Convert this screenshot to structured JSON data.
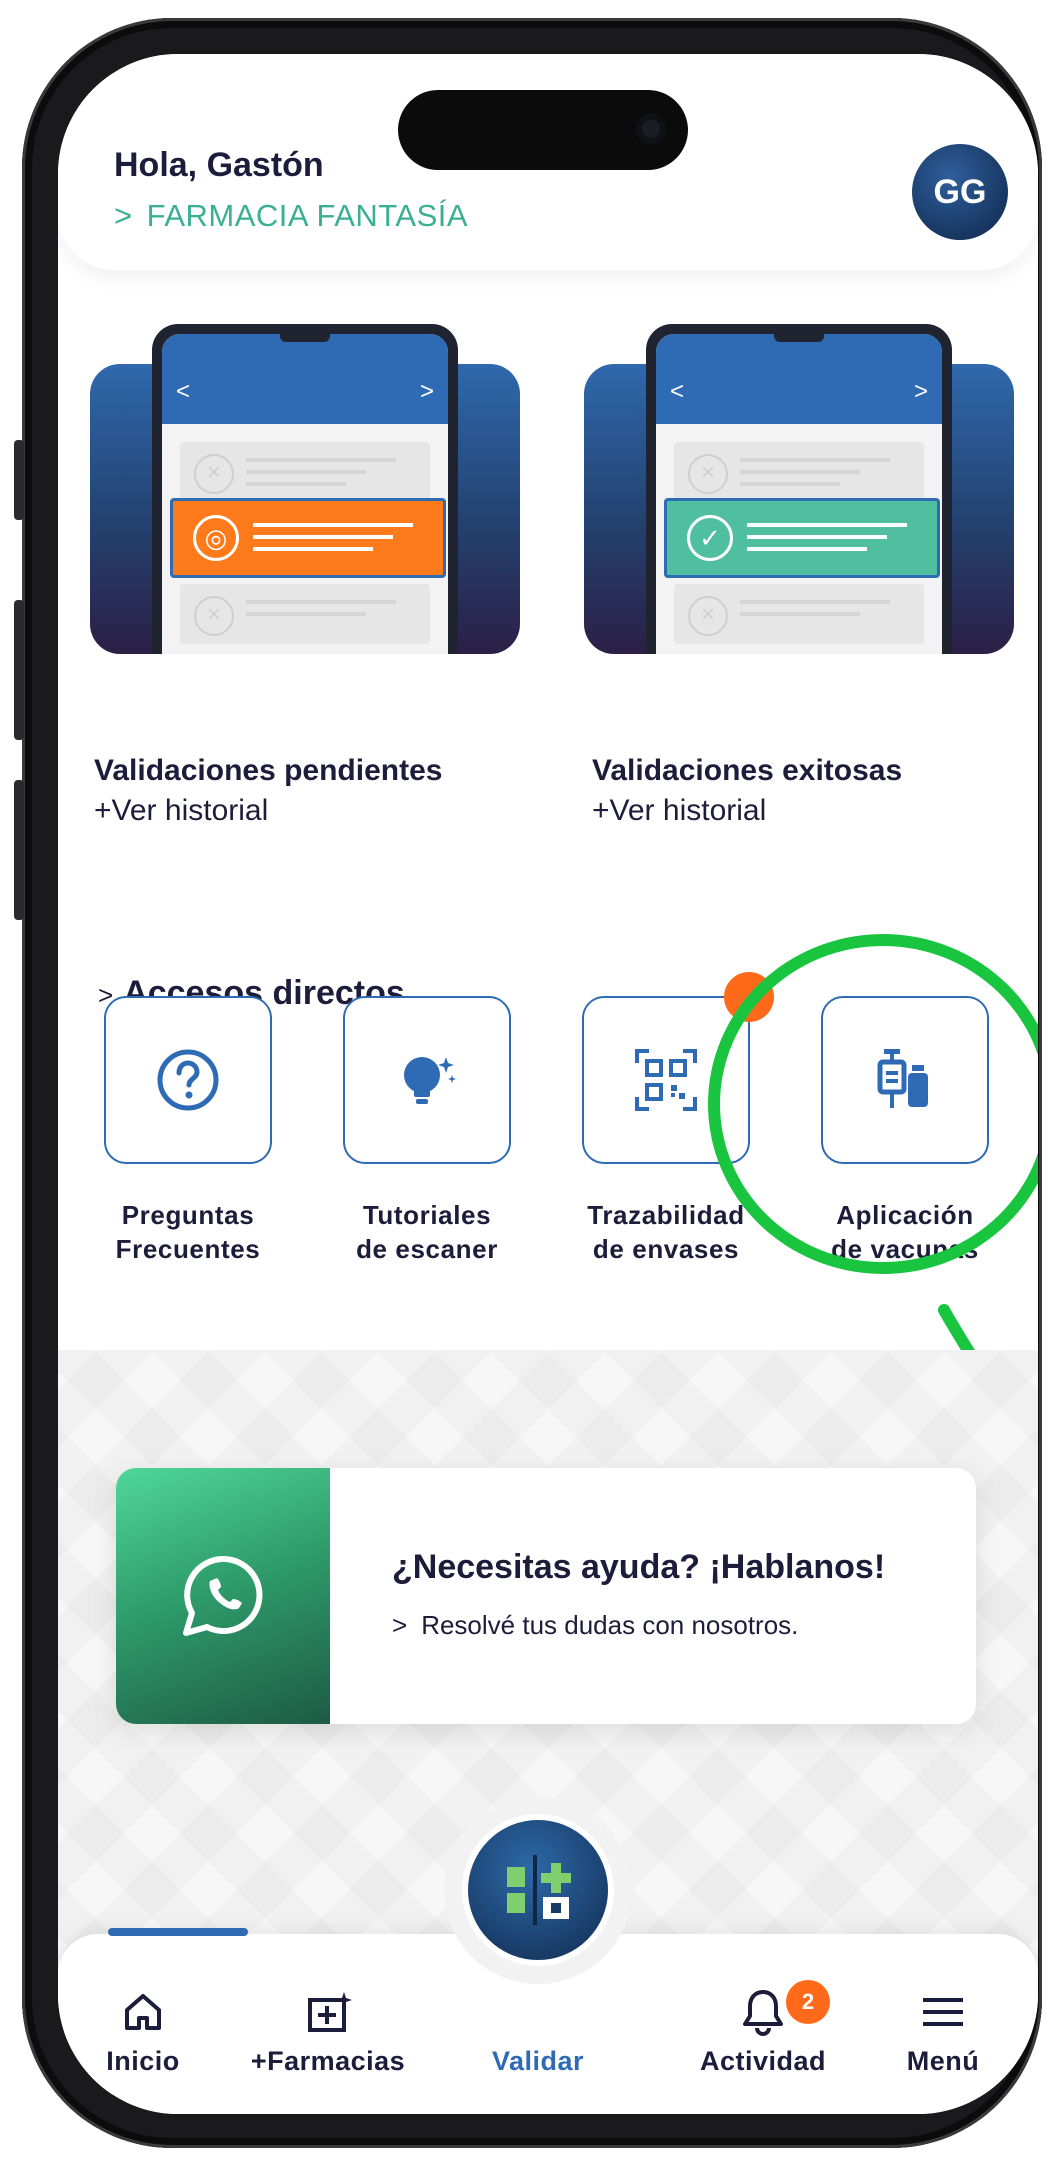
{
  "header": {
    "greeting": "Hola, Gastón",
    "pharmacy": "FARMACIA FANTASÍA",
    "avatar_initials": "GG"
  },
  "cards": [
    {
      "title": "Validaciones pendientes",
      "link": "+Ver historial",
      "accent": "#ff7a1a"
    },
    {
      "title": "Validaciones exitosas",
      "link": "+Ver historial",
      "accent": "#4fbf9f"
    }
  ],
  "shortcuts": {
    "title": "Accesos directos",
    "items": [
      {
        "line1": "Preguntas",
        "line2": "Frecuentes",
        "icon": "question-circle-icon"
      },
      {
        "line1": "Tutoriales",
        "line2": "de escaner",
        "icon": "lightbulb-icon"
      },
      {
        "line1": "Trazabilidad",
        "line2": "de envases",
        "icon": "qr-code-icon"
      },
      {
        "line1": "Aplicación",
        "line2": "de vacunas",
        "icon": "vaccine-icon"
      }
    ]
  },
  "help": {
    "title": "¿Necesitas ayuda? ¡Hablanos!",
    "subtitle": "Resolvé tus dudas con nosotros.",
    "icon": "whatsapp-icon"
  },
  "nav": {
    "items": [
      {
        "label": "Inicio",
        "icon": "home-icon"
      },
      {
        "label": "+Farmacias",
        "icon": "add-pharmacy-icon"
      },
      {
        "label": "Validar",
        "icon": "validate-icon"
      },
      {
        "label": "Actividad",
        "icon": "bell-icon",
        "badge": "2"
      },
      {
        "label": "Menú",
        "icon": "hamburger-icon"
      }
    ]
  },
  "colors": {
    "primary": "#2e6bb4",
    "dark_text": "#1c1d3a",
    "teal": "#3aaf94",
    "orange_badge": "#ff6a1a",
    "highlight_ring": "#19c53f"
  }
}
